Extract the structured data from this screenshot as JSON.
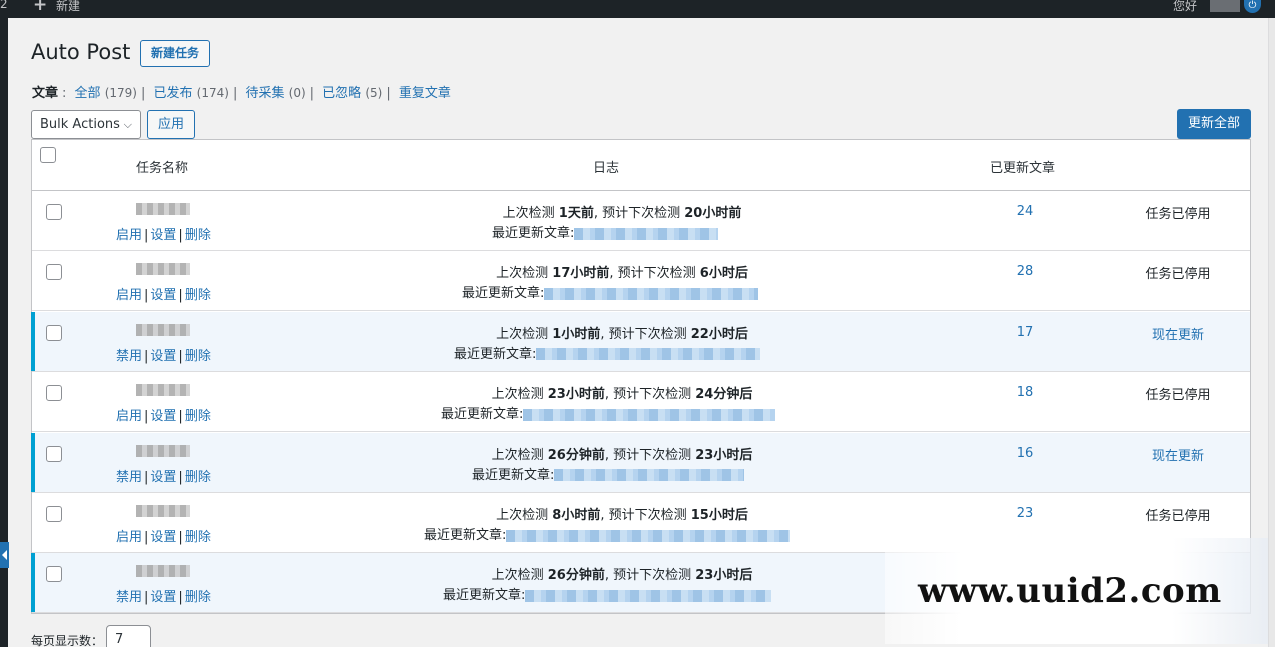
{
  "admin_bar": {
    "comment_count": "2",
    "new_label": "新建",
    "greeting": "您好"
  },
  "header": {
    "title": "Auto Post",
    "add_button": "新建任务"
  },
  "filters": {
    "label": "文章",
    "items": [
      {
        "label": "全部",
        "count": "(179)"
      },
      {
        "label": "已发布",
        "count": "(174)"
      },
      {
        "label": "待采集",
        "count": "(0)"
      },
      {
        "label": "已忽略",
        "count": "(5)"
      },
      {
        "label": "重复文章",
        "count": ""
      }
    ]
  },
  "toolbar": {
    "bulk_actions": "Bulk Actions",
    "apply": "应用",
    "update_all": "更新全部"
  },
  "table": {
    "columns": {
      "name": "任务名称",
      "log": "日志",
      "updated": "已更新文章"
    },
    "rows": [
      {
        "active": false,
        "toggle": "启用",
        "settings": "设置",
        "delete": "删除",
        "last_check_prefix": "上次检测 ",
        "last_check": "1天前",
        "next_check_prefix": ", 预计下次检测 ",
        "next_check": "20小时前",
        "recent_label": "最近更新文章:",
        "count": "24",
        "status": "任务已停用"
      },
      {
        "active": false,
        "toggle": "启用",
        "settings": "设置",
        "delete": "删除",
        "last_check_prefix": "上次检测 ",
        "last_check": "17小时前",
        "next_check_prefix": ", 预计下次检测 ",
        "next_check": "6小时后",
        "recent_label": "最近更新文章:",
        "count": "28",
        "status": "任务已停用"
      },
      {
        "active": true,
        "toggle": "禁用",
        "settings": "设置",
        "delete": "删除",
        "last_check_prefix": "上次检测 ",
        "last_check": "1小时前",
        "next_check_prefix": ", 预计下次检测 ",
        "next_check": "22小时后",
        "recent_label": "最近更新文章:",
        "count": "17",
        "status": "现在更新"
      },
      {
        "active": false,
        "toggle": "启用",
        "settings": "设置",
        "delete": "删除",
        "last_check_prefix": "上次检测 ",
        "last_check": "23小时前",
        "next_check_prefix": ", 预计下次检测 ",
        "next_check": "24分钟后",
        "recent_label": "最近更新文章:",
        "count": "18",
        "status": "任务已停用"
      },
      {
        "active": true,
        "toggle": "禁用",
        "settings": "设置",
        "delete": "删除",
        "last_check_prefix": "上次检测 ",
        "last_check": "26分钟前",
        "next_check_prefix": ", 预计下次检测 ",
        "next_check": "23小时后",
        "recent_label": "最近更新文章:",
        "count": "16",
        "status": "现在更新"
      },
      {
        "active": false,
        "toggle": "启用",
        "settings": "设置",
        "delete": "删除",
        "last_check_prefix": "上次检测 ",
        "last_check": "8小时前",
        "next_check_prefix": ", 预计下次检测 ",
        "next_check": "15小时后",
        "recent_label": "最近更新文章:",
        "count": "23",
        "status": "任务已停用"
      },
      {
        "active": true,
        "toggle": "禁用",
        "settings": "设置",
        "delete": "删除",
        "last_check_prefix": "上次检测 ",
        "last_check": "26分钟前",
        "next_check_prefix": ", 预计下次检测 ",
        "next_check": "23小时后",
        "recent_label": "最近更新文章:",
        "count": "",
        "status": ""
      }
    ]
  },
  "pagination": {
    "per_page_label": "每页显示数：",
    "per_page_value": "7"
  },
  "watermark": "www.uuid2.com",
  "colors": {
    "accent": "#2271b1",
    "active_border": "#00a0d2",
    "active_row_bg": "#f0f6fc"
  }
}
